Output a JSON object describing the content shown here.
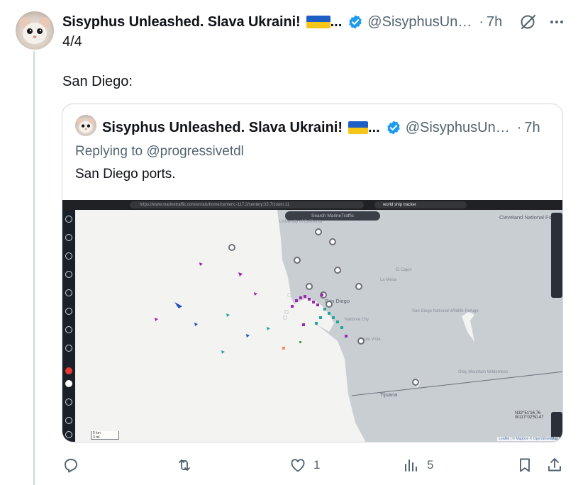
{
  "post": {
    "author_name": "Sisyphus Unleashed. Slava Ukraini!",
    "ellipsis": "...",
    "handle": "@SisyphusUn…",
    "dot": "·",
    "time": "7h",
    "line1": "4/4",
    "line2": "San Diego:"
  },
  "quote": {
    "author_name": "Sisyphus Unleashed. Slava Ukraini!",
    "ellipsis": "...",
    "handle": "@SisyphusUn…",
    "dot": "·",
    "time": "7h",
    "replying_prefix": "Replying to",
    "replying_to": "@progressivetdl",
    "text": "San Diego ports.",
    "screenshot": {
      "url": "https://www.marinetraffic.com/en/ais/home/centerx:-117.2/centery:32.7/zoom:11",
      "tab_search": "world ship tracker",
      "map_search_placeholder": "Search MarineTraffic",
      "labels": {
        "cleveland": "Cleveland National Forest",
        "san_diego": "San Diego",
        "tijuana": "Tijuana",
        "chula_vista": "Chula Vista",
        "el_cajon": "El Cajon",
        "la_mesa": "La Mesa",
        "national_city": "National City",
        "otay": "Otay Mountain Wilderness",
        "refuge": "San Diego National Wildlife Refuge",
        "univ": "University of California",
        "coordinates": "N32°51'16.76 W117°02'50.47",
        "scale_km": "5 km",
        "scale_mi": "3 mi",
        "attribution": "Leaflet | © Mapbox © OpenStreetMap"
      }
    }
  },
  "actions": {
    "reply_count": "",
    "repost_count": "",
    "like_count": "1",
    "views_count": "5"
  },
  "colors": {
    "accent": "#1d9bf0",
    "muted": "#536471",
    "border": "#cfd9de",
    "flag_blue": "#1d5fc4",
    "flag_yellow": "#f5c518"
  },
  "icons": [
    "verified-badge-icon",
    "grok-icon",
    "more-icon",
    "reply-icon",
    "repost-icon",
    "like-icon",
    "views-icon",
    "bookmark-icon",
    "share-icon"
  ]
}
